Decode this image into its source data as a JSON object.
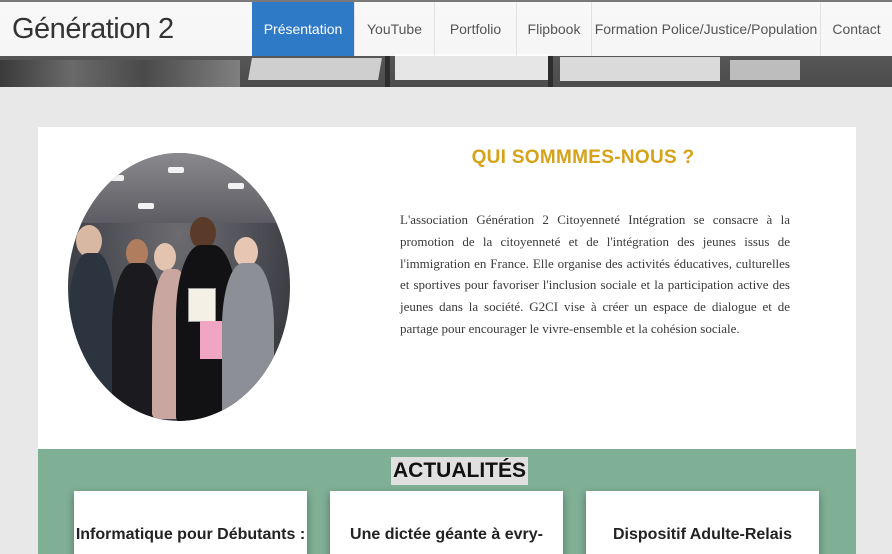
{
  "header": {
    "brand": "Génération 2",
    "nav": [
      {
        "label": "Présentation",
        "active": true
      },
      {
        "label": "YouTube",
        "active": false
      },
      {
        "label": "Portfolio",
        "active": false
      },
      {
        "label": "Flipbook",
        "active": false
      },
      {
        "label": "Formation Police/Justice/Population",
        "active": false
      },
      {
        "label": "Contact",
        "active": false
      }
    ]
  },
  "about": {
    "title": "QUI SOMMMES-NOUS ?",
    "text": "L'association Génération 2 Citoyenneté Intégration se consacre à la promotion de la citoyenneté et de l'intégration des jeunes issus de l'immigration en France. Elle organise des activités éducatives, culturelles et sportives pour favoriser l'inclusion sociale et la participation active des jeunes dans la société. G2CI vise à créer un espace de dialogue et de partage pour encourager le vivre-ensemble et la cohésion sociale."
  },
  "news": {
    "title": "ACTUALITÉS",
    "cards": [
      {
        "title": "Informatique pour Débutants :"
      },
      {
        "title": "Une dictée géante à evry-"
      },
      {
        "title": "Dispositif Adulte-Relais"
      }
    ]
  },
  "colors": {
    "nav_active": "#2f7ac6",
    "title_gold": "#d5a21a",
    "news_bg": "#7fb096"
  }
}
